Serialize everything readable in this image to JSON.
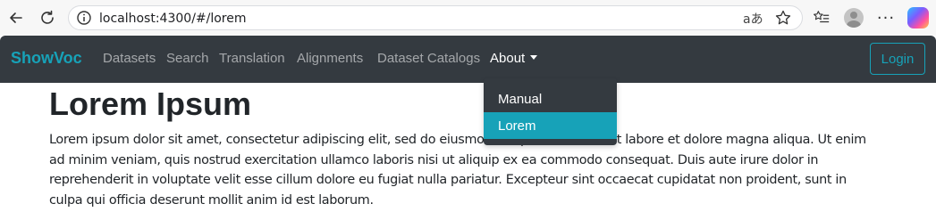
{
  "browser": {
    "url": "localhost:4300/#/lorem",
    "translate_icon_text": "aあ",
    "more_icon_text": "···"
  },
  "navbar": {
    "brand": "ShowVoc",
    "links": [
      "Datasets",
      "Search",
      "Translation",
      "Alignments",
      "Dataset Catalogs"
    ],
    "about_label": "About",
    "login_label": "Login"
  },
  "dropdown": {
    "items": [
      "Manual",
      "Lorem"
    ],
    "selected_item": "Lorem"
  },
  "content": {
    "title": "Lorem Ipsum",
    "paragraph": "Lorem ipsum dolor sit amet, consectetur adipiscing elit, sed do eiusmod tempor incididunt ut labore et dolore magna aliqua. Ut enim ad minim veniam, quis nostrud exercitation ullamco laboris nisi ut aliquip ex ea commodo consequat. Duis aute irure dolor in reprehenderit in voluptate velit esse cillum dolore eu fugiat nulla pariatur. Excepteur sint occaecat cupidatat non proident, sunt in culpa qui officia deserunt mollit anim id est laborum."
  },
  "colors": {
    "navbar_bg": "#343a40",
    "accent": "#17a2b8"
  }
}
